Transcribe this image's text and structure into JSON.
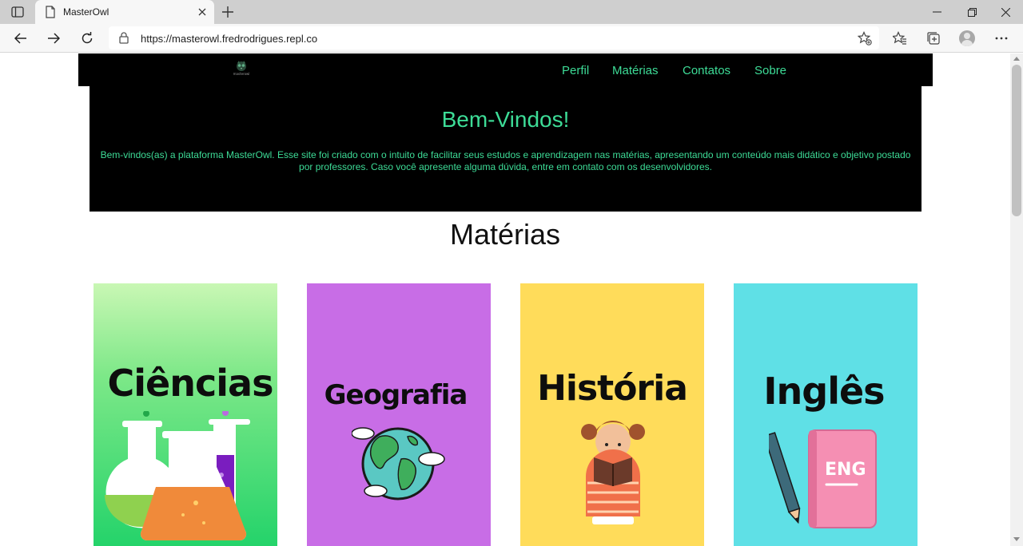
{
  "browser": {
    "tab_title": "MasterOwl",
    "url_host": "https://masterowl.fredrodrigues.repl.co"
  },
  "site": {
    "logo_text": "masterowl",
    "nav": [
      {
        "label": "Perfil"
      },
      {
        "label": "Matérias"
      },
      {
        "label": "Contatos"
      },
      {
        "label": "Sobre"
      }
    ],
    "hero": {
      "title": "Bem-Vindos!",
      "text": "Bem-vindos(as) a plataforma MasterOwl. Esse site foi criado com o intuito de facilitar seus estudos e aprendizagem nas matérias, apresentando um conteúdo mais didático e objetivo postado por professores. Caso você apresente alguma dúvida, entre em contato com os desenvolvidores."
    },
    "section_title": "Matérias",
    "cards": [
      {
        "label": "Ciências",
        "color": "#3ee07a",
        "icon": "lab-flasks-icon"
      },
      {
        "label": "Geografia",
        "color": "#c86de6",
        "icon": "globe-icon"
      },
      {
        "label": "História",
        "color": "#ffdc5a",
        "icon": "girl-reading-icon"
      },
      {
        "label": "Inglês",
        "color": "#5fe0e6",
        "icon": "english-book-icon"
      }
    ]
  },
  "colors": {
    "accent": "#3ddc97",
    "nav_background": "#000000"
  }
}
